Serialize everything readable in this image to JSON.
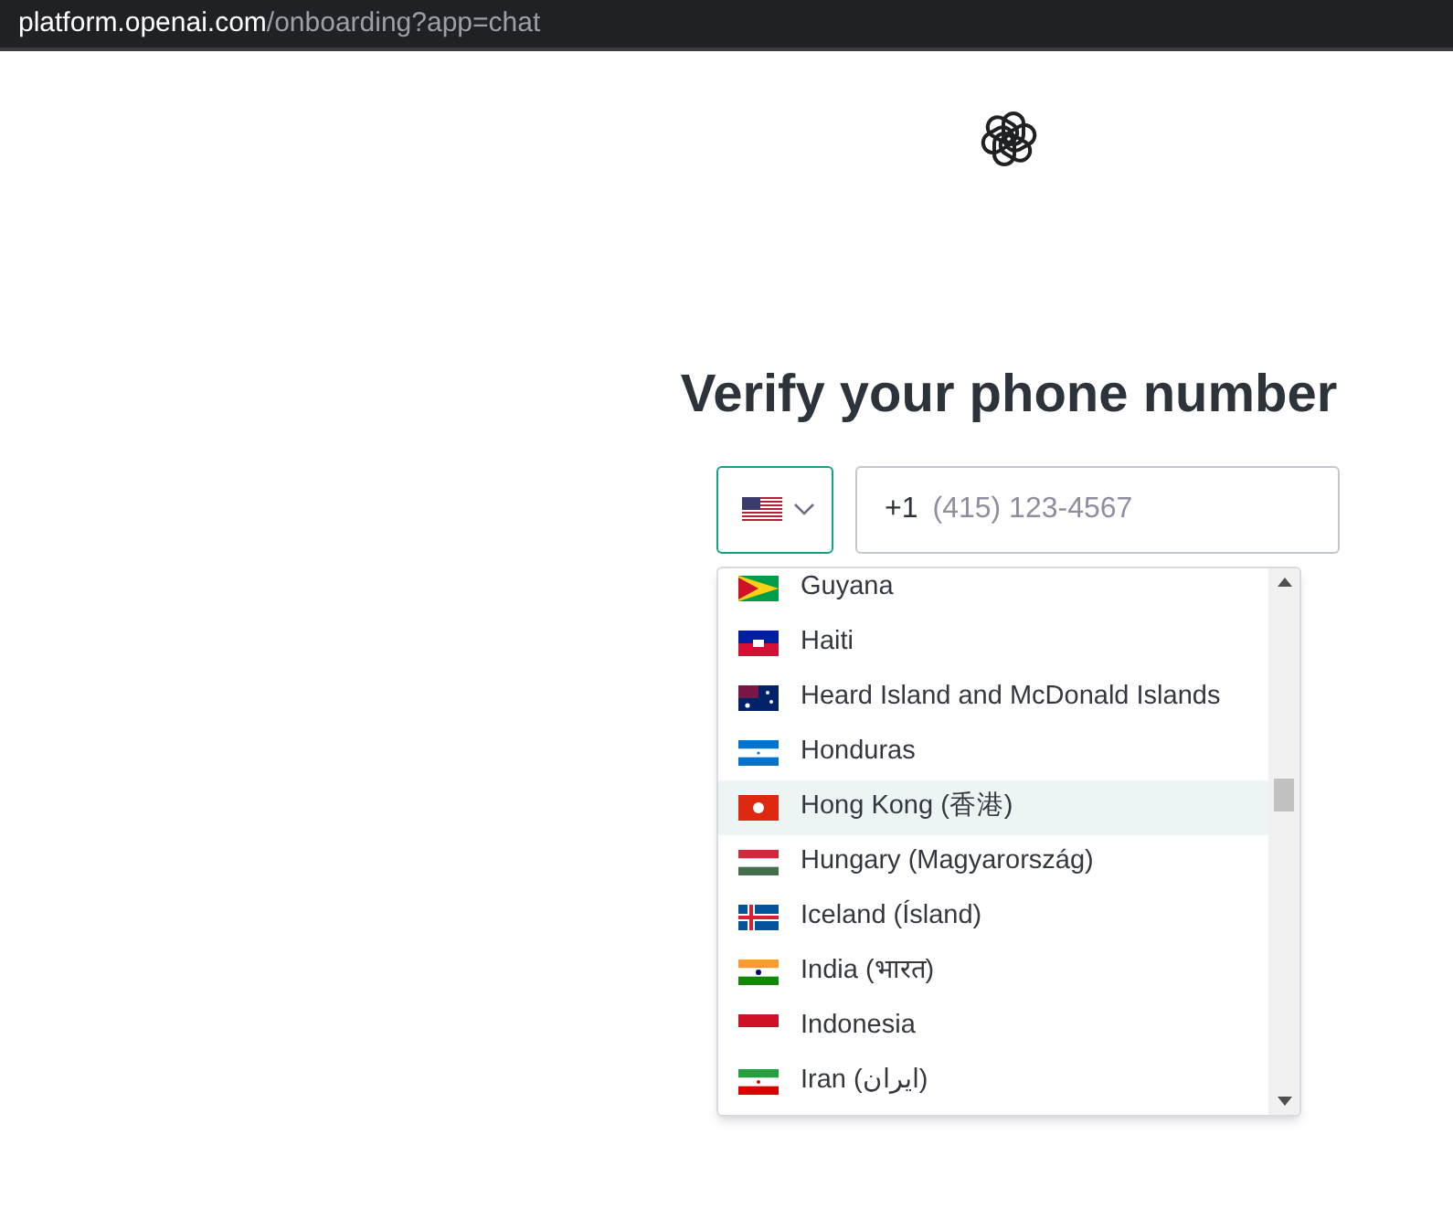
{
  "address_bar": {
    "domain": "platform.openai.com",
    "path": "/onboarding?app=chat"
  },
  "title": "Verify your phone number",
  "phone_field": {
    "prefix": "+1",
    "placeholder": "(415) 123-4567"
  },
  "country_list": [
    {
      "label": "Guyana",
      "selected": false
    },
    {
      "label": "Haiti",
      "selected": false
    },
    {
      "label": "Heard Island and McDonald Islands",
      "selected": false
    },
    {
      "label": "Honduras",
      "selected": false
    },
    {
      "label": "Hong Kong (香港)",
      "selected": true
    },
    {
      "label": "Hungary (Magyarország)",
      "selected": false
    },
    {
      "label": "Iceland (Ísland)",
      "selected": false
    },
    {
      "label": "India (भारत)",
      "selected": false
    },
    {
      "label": "Indonesia",
      "selected": false
    },
    {
      "label": "Iran (‫ایران‬‎)",
      "selected": false
    }
  ]
}
